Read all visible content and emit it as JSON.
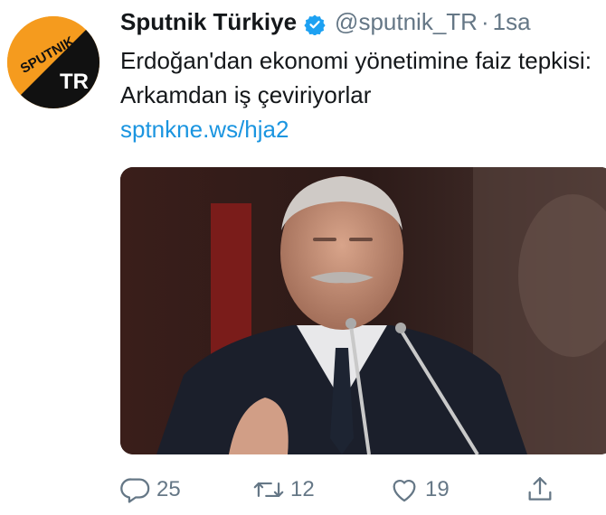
{
  "tweet": {
    "author_name": "Sputnik Türkiye",
    "handle": "@sputnik_TR",
    "separator": "·",
    "time": "1sa",
    "text": "Erdoğan'dan ekonomi yönetimine faiz tepkisi: Arkamdan iş çeviriyorlar",
    "link": "sptnkne.ws/hja2"
  },
  "avatar": {
    "logo_top": "SPUTNIK",
    "logo_bottom": "TR"
  },
  "actions": {
    "replies": "25",
    "retweets": "12",
    "likes": "19"
  },
  "icons": {
    "verified": "verified-badge-icon",
    "reply": "reply-icon",
    "retweet": "retweet-icon",
    "like": "heart-icon",
    "share": "share-icon"
  },
  "colors": {
    "link": "#1b95e0",
    "verified": "#1da1f2",
    "secondary_text": "#657786",
    "avatar_orange": "#f59b1e"
  }
}
